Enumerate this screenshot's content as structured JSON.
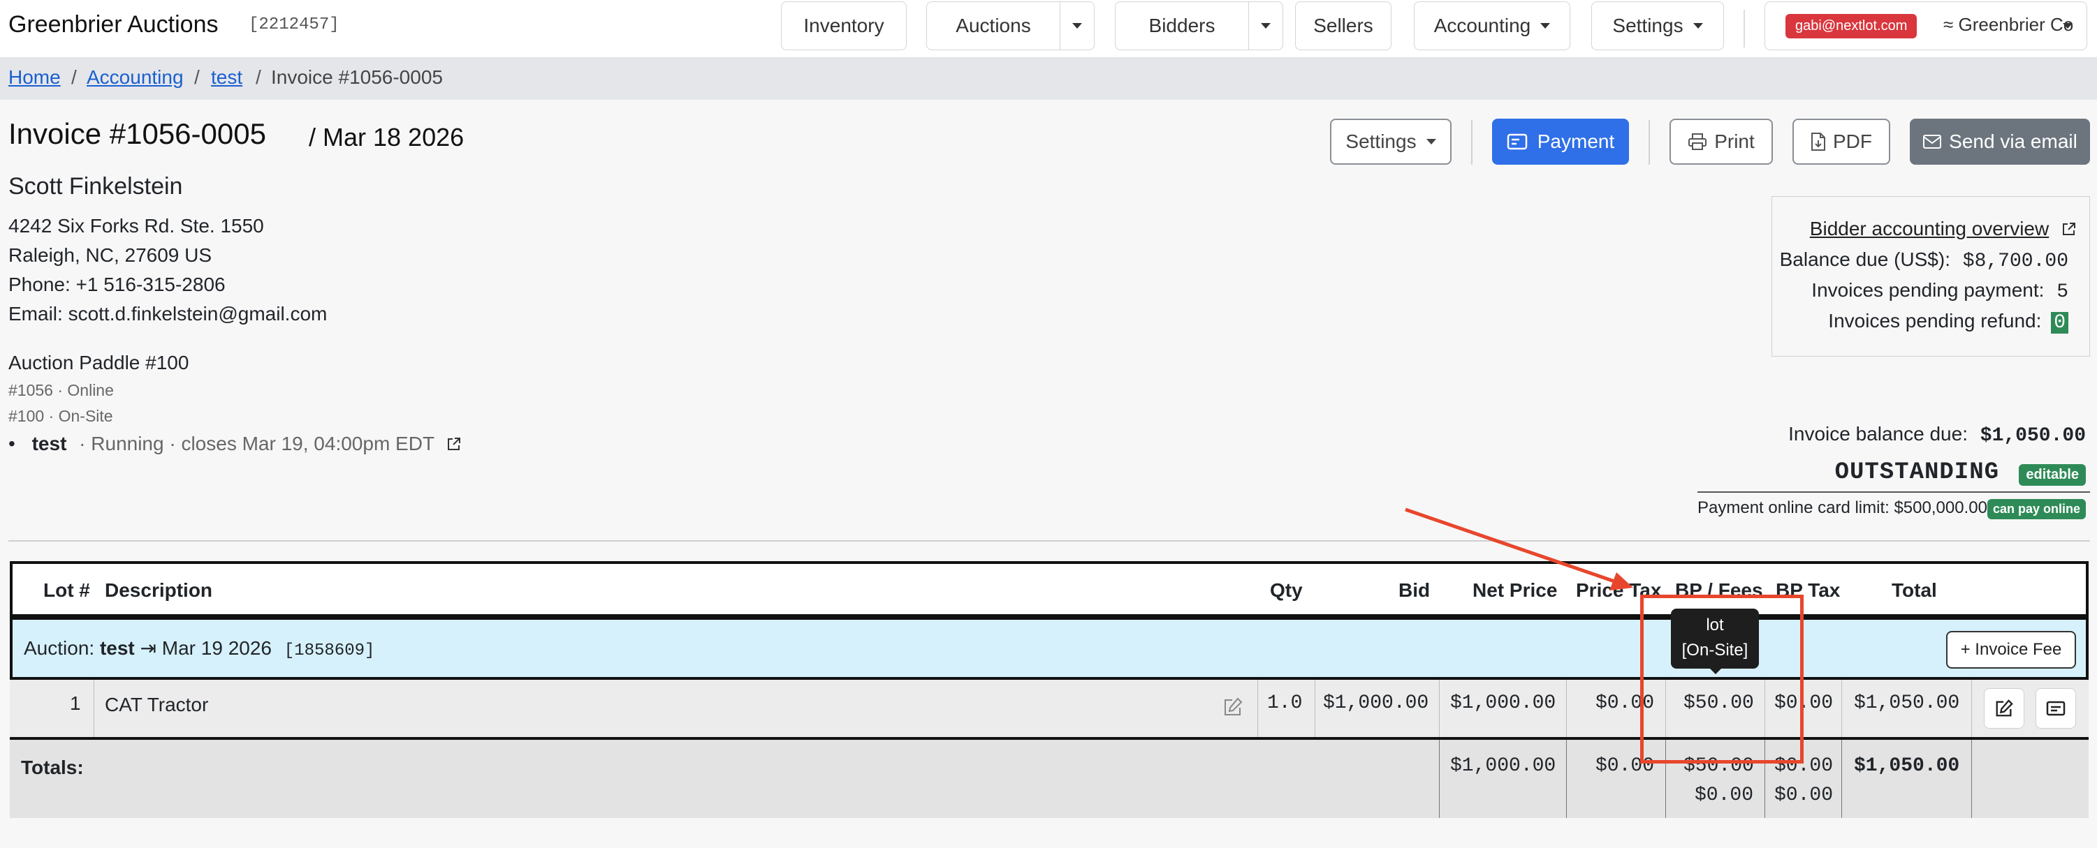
{
  "nav": {
    "brand": "Greenbrier Auctions",
    "auction_id": "[2212457]",
    "inventory": "Inventory",
    "auctions": "Auctions",
    "bidders": "Bidders",
    "sellers": "Sellers",
    "accounting": "Accounting",
    "settings": "Settings",
    "user_email": "gabi@nextlot.com",
    "org": "≈ Greenbrier Co"
  },
  "breadcrumb": {
    "home": "Home",
    "accounting": "Accounting",
    "test": "test",
    "current": "Invoice #1056-0005",
    "sep": "/"
  },
  "header": {
    "title": "Invoice #1056-0005",
    "date": "/  Mar 18 2026",
    "settings_label": "Settings",
    "payment_label": "Payment",
    "print_label": "Print",
    "pdf_label": "PDF",
    "email_label": "Send via email"
  },
  "customer": {
    "name": "Scott Finkelstein",
    "address1": "4242 Six Forks Rd. Ste. 1550",
    "address2": "Raleigh, NC, 27609 US",
    "phone": "Phone: +1 516-315-2806",
    "email": "Email: scott.d.finkelstein@gmail.com",
    "paddle": "Auction Paddle #100",
    "sub1": "#1056 · Online",
    "sub2": "#100 · On-Site",
    "auction_bullet": "•",
    "auction_name": "test",
    "auction_status": "· Running · closes Mar 19, 04:00pm EDT"
  },
  "overview": {
    "link": "Bidder accounting overview",
    "balance_label": "Balance due (US$):",
    "balance_value": "$8,700.00",
    "pending_pay_label": "Invoices pending payment:",
    "pending_pay_value": "5",
    "pending_refund_label": "Invoices pending refund:",
    "pending_refund_value": "0"
  },
  "status": {
    "invoice_balance_label": "Invoice balance due:",
    "invoice_balance_value": "$1,050.00",
    "outstanding": "OUTSTANDING",
    "editable": "editable",
    "card_limit": "Payment online card limit: $500,000.00",
    "can_pay": "can pay online"
  },
  "table": {
    "headers": {
      "lot": "Lot #",
      "description": "Description",
      "qty": "Qty",
      "bid": "Bid",
      "net_price": "Net Price",
      "price_tax": "Price Tax",
      "bp_fees": "BP / Fees",
      "bp_tax": "BP Tax",
      "total": "Total"
    },
    "auction_row": {
      "prefix": "Auction:",
      "name": "test",
      "arrow": "⇥",
      "date": "Mar 19 2026",
      "id": "[1858609]",
      "fee_button": "+ Invoice Fee"
    },
    "rows": [
      {
        "lot": "1",
        "description": "CAT Tractor",
        "qty": "1.0",
        "bid": "$1,000.00",
        "net_price": "$1,000.00",
        "price_tax": "$0.00",
        "bp_fees": "$50.00",
        "bp_tax": "$0.00",
        "total": "$1,050.00"
      }
    ],
    "totals": {
      "label": "Totals:",
      "net_price": "$1,000.00",
      "price_tax": "$0.00",
      "bp_fees": "$50.00",
      "bp_fees2": "$0.00",
      "bp_tax": "$0.00",
      "bp_tax2": "$0.00",
      "total": "$1,050.00"
    }
  },
  "tooltip": {
    "line1": "lot",
    "line2": "[On-Site]"
  },
  "colors": {
    "primary": "#2f6fe8",
    "success": "#2e8b57",
    "danger": "#d9363e",
    "annotation": "#e8462c"
  }
}
